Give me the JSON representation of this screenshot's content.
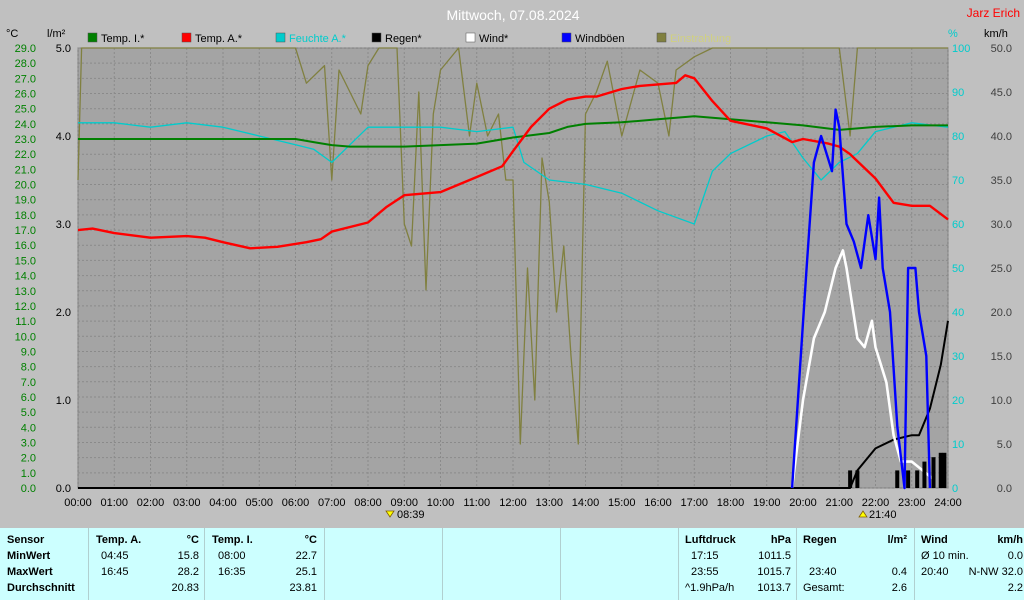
{
  "header": {
    "title": "Mittwoch, 07.08.2024",
    "author": "Jarz Erich"
  },
  "axes": {
    "left_temp_unit": "°C",
    "left_rain_unit": "l/m²",
    "right_pct_unit": "%",
    "right_wind_unit": "km/h",
    "temp_ticks": [
      "0.0",
      "1.0",
      "2.0",
      "3.0",
      "4.0",
      "5.0",
      "6.0",
      "7.0",
      "8.0",
      "9.0",
      "10.0",
      "11.0",
      "12.0",
      "13.0",
      "14.0",
      "15.0",
      "16.0",
      "17.0",
      "18.0",
      "19.0",
      "20.0",
      "21.0",
      "22.0",
      "23.0",
      "24.0",
      "25.0",
      "26.0",
      "27.0",
      "28.0",
      "29.0"
    ],
    "rain_ticks": [
      "0.0",
      "1.0",
      "2.0",
      "3.0",
      "4.0",
      "5.0"
    ],
    "pct_ticks": [
      "0",
      "10",
      "20",
      "30",
      "40",
      "50",
      "60",
      "70",
      "80",
      "90",
      "100"
    ],
    "wind_ticks": [
      "0.0",
      "5.0",
      "10.0",
      "15.0",
      "20.0",
      "25.0",
      "30.0",
      "35.0",
      "40.0",
      "45.0",
      "50.0"
    ],
    "time_ticks": [
      "00:00",
      "01:00",
      "02:00",
      "03:00",
      "04:00",
      "05:00",
      "06:00",
      "07:00",
      "08:00",
      "09:00",
      "10:00",
      "11:00",
      "12:00",
      "13:00",
      "14:00",
      "15:00",
      "16:00",
      "17:00",
      "18:00",
      "19:00",
      "20:00",
      "21:00",
      "22:00",
      "23:00",
      "24:00"
    ],
    "sunrise_label": "08:39",
    "sunset_label": "21:40",
    "colors": {
      "temp_scale": "#008000",
      "pct_scale": "#00cccc",
      "wind_scale": "#404040"
    }
  },
  "chart_data": {
    "type": "line",
    "x_unit": "hours",
    "xlim": [
      0,
      24
    ],
    "series": [
      {
        "name": "Temp. I.*",
        "color": "#008000",
        "axis": "temp",
        "points": [
          [
            0,
            23.0
          ],
          [
            1,
            23.0
          ],
          [
            2,
            23.0
          ],
          [
            3,
            23.0
          ],
          [
            4,
            23.0
          ],
          [
            5,
            23.0
          ],
          [
            6,
            23.0
          ],
          [
            6.5,
            22.8
          ],
          [
            7,
            22.6
          ],
          [
            7.5,
            22.5
          ],
          [
            8,
            22.5
          ],
          [
            9,
            22.5
          ],
          [
            10,
            22.6
          ],
          [
            11,
            22.7
          ],
          [
            12,
            23.1
          ],
          [
            13,
            23.4
          ],
          [
            13.5,
            23.8
          ],
          [
            14,
            24.0
          ],
          [
            15,
            24.1
          ],
          [
            16,
            24.3
          ],
          [
            17,
            24.5
          ],
          [
            18,
            24.3
          ],
          [
            19,
            24.1
          ],
          [
            20,
            23.9
          ],
          [
            21,
            23.6
          ],
          [
            22,
            23.8
          ],
          [
            23,
            23.9
          ],
          [
            24,
            23.9
          ]
        ]
      },
      {
        "name": "Temp. A.*",
        "color": "#ff0000",
        "axis": "temp",
        "points": [
          [
            0,
            17.0
          ],
          [
            0.4,
            17.1
          ],
          [
            1,
            16.8
          ],
          [
            2,
            16.5
          ],
          [
            3,
            16.6
          ],
          [
            3.5,
            16.5
          ],
          [
            4,
            16.2
          ],
          [
            4.75,
            15.8
          ],
          [
            5.5,
            15.9
          ],
          [
            6.3,
            16.2
          ],
          [
            6.7,
            16.4
          ],
          [
            7,
            16.9
          ],
          [
            8,
            17.5
          ],
          [
            8.5,
            18.5
          ],
          [
            9,
            19.3
          ],
          [
            10,
            19.5
          ],
          [
            11,
            20.5
          ],
          [
            11.7,
            21.2
          ],
          [
            12,
            22.2
          ],
          [
            12.5,
            23.8
          ],
          [
            13,
            25.0
          ],
          [
            13.5,
            25.6
          ],
          [
            14,
            25.8
          ],
          [
            14.3,
            25.8
          ],
          [
            15,
            26.3
          ],
          [
            15.5,
            26.5
          ],
          [
            16,
            26.6
          ],
          [
            16.5,
            26.7
          ],
          [
            16.75,
            27.2
          ],
          [
            17,
            27.0
          ],
          [
            17.5,
            25.5
          ],
          [
            18,
            24.2
          ],
          [
            19,
            23.7
          ],
          [
            19.7,
            22.8
          ],
          [
            20,
            23.0
          ],
          [
            20.7,
            22.7
          ],
          [
            21,
            22.5
          ],
          [
            21.3,
            22.0
          ],
          [
            22,
            20.4
          ],
          [
            22.5,
            18.8
          ],
          [
            23,
            18.6
          ],
          [
            23.5,
            18.6
          ],
          [
            24,
            17.7
          ]
        ]
      },
      {
        "name": "Feuchte A.*",
        "color": "#00cccc",
        "axis": "pct",
        "points": [
          [
            0,
            83
          ],
          [
            1,
            83
          ],
          [
            2,
            82
          ],
          [
            3,
            83
          ],
          [
            4,
            82
          ],
          [
            5,
            80
          ],
          [
            6,
            78
          ],
          [
            6.5,
            77
          ],
          [
            7,
            74
          ],
          [
            7.5,
            78
          ],
          [
            8,
            82
          ],
          [
            9,
            82
          ],
          [
            10,
            82
          ],
          [
            11,
            81
          ],
          [
            12,
            82
          ],
          [
            12.3,
            74
          ],
          [
            13,
            70
          ],
          [
            14,
            69
          ],
          [
            15,
            67
          ],
          [
            16,
            63
          ],
          [
            17,
            60
          ],
          [
            17.5,
            72
          ],
          [
            18,
            76
          ],
          [
            19,
            80
          ],
          [
            19.5,
            81
          ],
          [
            20,
            75
          ],
          [
            20.5,
            70
          ],
          [
            21,
            74
          ],
          [
            21.5,
            76
          ],
          [
            22,
            81
          ],
          [
            22.5,
            82
          ],
          [
            23,
            83
          ],
          [
            24,
            82
          ]
        ]
      },
      {
        "name": "Regen*",
        "color": "#000000",
        "axis": "rain",
        "points": [
          [
            0,
            0
          ],
          [
            21.3,
            0
          ],
          [
            21.5,
            0.2
          ],
          [
            22,
            0.45
          ],
          [
            22.5,
            0.55
          ],
          [
            23,
            0.6
          ],
          [
            23.2,
            0.6
          ],
          [
            23.5,
            0.9
          ],
          [
            23.8,
            1.4
          ],
          [
            24,
            1.9
          ]
        ]
      },
      {
        "name": "Wind*",
        "color": "#ffffff",
        "axis": "wind",
        "points": [
          [
            19.7,
            0
          ],
          [
            20,
            10
          ],
          [
            20.3,
            17
          ],
          [
            20.6,
            20
          ],
          [
            20.9,
            25
          ],
          [
            21.1,
            27
          ],
          [
            21.2,
            25
          ],
          [
            21.5,
            17
          ],
          [
            21.7,
            16
          ],
          [
            21.9,
            19
          ],
          [
            22,
            16
          ],
          [
            22.3,
            12
          ],
          [
            22.5,
            6
          ],
          [
            22.7,
            3
          ],
          [
            23,
            3
          ],
          [
            23.3,
            2
          ],
          [
            23.6,
            1
          ]
        ]
      },
      {
        "name": "Windböen",
        "color": "#0000ff",
        "axis": "wind",
        "points": [
          [
            19.7,
            0
          ],
          [
            20.1,
            25
          ],
          [
            20.3,
            37
          ],
          [
            20.5,
            40
          ],
          [
            20.8,
            36
          ],
          [
            20.9,
            43
          ],
          [
            21,
            41
          ],
          [
            21.2,
            30
          ],
          [
            21.4,
            28
          ],
          [
            21.6,
            25
          ],
          [
            21.8,
            31
          ],
          [
            22,
            26
          ],
          [
            22.1,
            33
          ],
          [
            22.2,
            25
          ],
          [
            22.4,
            20
          ],
          [
            22.6,
            7
          ],
          [
            22.8,
            0
          ],
          [
            22.9,
            25
          ],
          [
            23.1,
            25
          ],
          [
            23.2,
            20
          ],
          [
            23.4,
            15
          ],
          [
            23.5,
            0
          ]
        ]
      },
      {
        "name": "Einstrahlung",
        "color": "#808040",
        "axis": "pct",
        "points": [
          [
            0,
            70
          ],
          [
            0.1,
            100
          ],
          [
            6,
            100
          ],
          [
            6.3,
            92
          ],
          [
            6.8,
            96
          ],
          [
            7,
            70
          ],
          [
            7.2,
            95
          ],
          [
            7.5,
            90
          ],
          [
            7.8,
            85
          ],
          [
            8,
            96
          ],
          [
            8.3,
            100
          ],
          [
            8.8,
            100
          ],
          [
            9,
            60
          ],
          [
            9.2,
            55
          ],
          [
            9.4,
            90
          ],
          [
            9.6,
            45
          ],
          [
            9.8,
            85
          ],
          [
            10,
            95
          ],
          [
            10.5,
            100
          ],
          [
            10.8,
            80
          ],
          [
            11,
            92
          ],
          [
            11.3,
            80
          ],
          [
            11.6,
            85
          ],
          [
            11.8,
            70
          ],
          [
            12,
            70
          ],
          [
            12.2,
            10
          ],
          [
            12.4,
            50
          ],
          [
            12.6,
            20
          ],
          [
            12.8,
            75
          ],
          [
            13,
            65
          ],
          [
            13.2,
            40
          ],
          [
            13.4,
            55
          ],
          [
            13.6,
            30
          ],
          [
            13.8,
            10
          ],
          [
            14,
            85
          ],
          [
            14.3,
            90
          ],
          [
            14.6,
            97
          ],
          [
            15,
            80
          ],
          [
            15.5,
            95
          ],
          [
            16,
            92
          ],
          [
            16.3,
            80
          ],
          [
            16.5,
            95
          ],
          [
            17,
            98
          ],
          [
            17.5,
            100
          ],
          [
            18,
            100
          ],
          [
            19,
            100
          ],
          [
            20,
            100
          ],
          [
            21,
            100
          ],
          [
            21.3,
            80
          ],
          [
            21.5,
            100
          ],
          [
            22,
            100
          ],
          [
            23,
            100
          ],
          [
            24,
            100
          ]
        ]
      }
    ],
    "rain_bars": {
      "color": "#000000",
      "points": [
        [
          21.3,
          0.2
        ],
        [
          21.5,
          0.2
        ],
        [
          22.6,
          0.2
        ],
        [
          22.9,
          0.2
        ],
        [
          23.15,
          0.2
        ],
        [
          23.35,
          0.3
        ],
        [
          23.6,
          0.35
        ],
        [
          23.8,
          0.4
        ],
        [
          23.9,
          0.4
        ]
      ]
    },
    "ylim_temp": [
      0,
      29
    ],
    "ylim_rain": [
      0,
      5
    ],
    "ylim_pct": [
      0,
      100
    ],
    "ylim_wind": [
      0,
      50
    ],
    "grid": true,
    "legend": "top"
  },
  "stats": {
    "sensor": {
      "header": "Sensor",
      "rows": [
        "MinWert",
        "MaxWert",
        "Durchschnitt"
      ]
    },
    "temp_a": {
      "header": "Temp. A.",
      "unit": "°C",
      "min_time": "04:45",
      "min_val": "15.8",
      "max_time": "16:45",
      "max_val": "28.2",
      "avg": "20.83"
    },
    "temp_i": {
      "header": "Temp. I.",
      "unit": "°C",
      "min_time": "08:00",
      "min_val": "22.7",
      "max_time": "16:35",
      "max_val": "25.1",
      "avg": "23.81"
    },
    "pressure": {
      "header": "Luftdruck",
      "unit": "hPa",
      "min_time": "17:15",
      "min_val": "1011.5",
      "max_time": "23:55",
      "max_val": "1015.7",
      "trend": "^1.9hPa/h",
      "avg": "1013.7"
    },
    "rain": {
      "header": "Regen",
      "unit": "l/m²",
      "max_time": "23:40",
      "max_val": "0.4",
      "total_label": "Gesamt:",
      "total": "2.6"
    },
    "wind": {
      "header": "Wind",
      "unit": "km/h",
      "avg_label": "Ø 10 min.",
      "avg_val": "0.0",
      "max_time": "20:40",
      "max_val": "N-NW 32.0",
      "avg": "2.2"
    }
  }
}
